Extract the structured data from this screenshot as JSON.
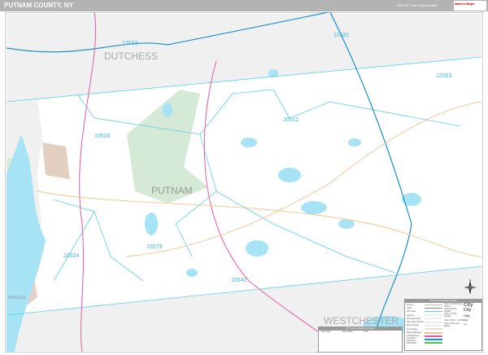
{
  "header": {
    "title": "PUTNAM COUNTY, NY",
    "edition": "2026 ZIP Code Premium Edition",
    "logo": "Market Maps"
  },
  "counties": [
    "DUTCHESS",
    "PUTNAM",
    "WESTCHESTER",
    "ORANGE"
  ],
  "zip_codes": [
    "12533",
    "12531",
    "12563",
    "10512",
    "10516",
    "10579",
    "10524",
    "10541"
  ],
  "colors": {
    "water": "#a6e3f5",
    "zip_boundary": "#5ad0ec",
    "outside_county": "#f0f0f0",
    "park": "#d4ead6",
    "interstate": "#1d8fd0",
    "us_highway": "#e55aa8",
    "state_highway": "#f2c48a",
    "urban": "#e3cfc0"
  },
  "legend": {
    "title": "Putnam County Map Legend",
    "left": [
      {
        "label": "County",
        "color": "#bbbbbb"
      },
      {
        "label": "State",
        "color": "#888888"
      },
      {
        "label": "ZIP Code",
        "color": "#5ad0ec"
      },
      {
        "label": "Airports",
        "color": "#eeeeee"
      },
      {
        "label": "Primary Roads",
        "color": "#eeeeee"
      },
      {
        "label": "Secondary Roads",
        "color": "#eeeeee"
      },
      {
        "label": "Minor Roads",
        "color": "#eeeeee"
      },
      {
        "label": "Gov Range",
        "color": "#f6d7dc"
      },
      {
        "label": "State Highways",
        "color": "#f2c48a"
      },
      {
        "label": "US Highways",
        "color": "#e55aa8"
      },
      {
        "label": "Interstate Highways",
        "color": "#1d8fd0"
      },
      {
        "label": "Toll Roads",
        "color": "#4cc45a"
      }
    ],
    "right": [
      {
        "label": "Cities 100,000 and Above",
        "sample": "City"
      },
      {
        "label": "Cities 50,000 - 99,999",
        "sample": "City"
      },
      {
        "label": "Cities 25,000 - 49,999",
        "sample": "City"
      },
      {
        "label": "Cities 5,000 - 24,999",
        "sample": "City"
      },
      {
        "label": "Cities 5,000 and Below",
        "sample": "City"
      }
    ]
  },
  "index": {
    "title": "ZIP Codes Index/Grid Location",
    "headers": [
      "ZIP Code",
      "Post Office",
      "Grid"
    ]
  },
  "compass": "N"
}
